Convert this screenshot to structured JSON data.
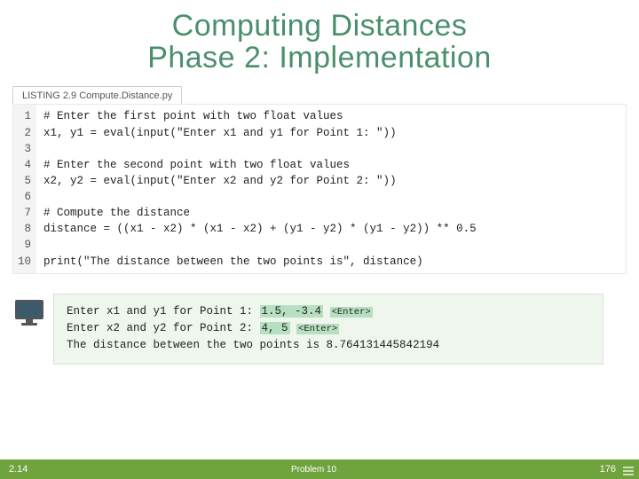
{
  "title": {
    "line1": "Computing Distances",
    "line2": "Phase 2: Implementation"
  },
  "listing_label": "LISTING 2.9 Compute.Distance.py",
  "code": {
    "gutter": "1\n2\n3\n4\n5\n6\n7\n8\n9\n10",
    "body": "# Enter the first point with two float values\nx1, y1 = eval(input(\"Enter x1 and y1 for Point 1: \"))\n\n# Enter the second point with two float values\nx2, y2 = eval(input(\"Enter x2 and y2 for Point 2: \"))\n\n# Compute the distance\ndistance = ((x1 - x2) * (x1 - x2) + (y1 - y2) * (y1 - y2)) ** 0.5\n\nprint(\"The distance between the two points is\", distance)"
  },
  "terminal": {
    "l1a": "Enter x1 and y1 for Point 1: ",
    "l1b": "1.5, -3.4",
    "enter": "<Enter>",
    "l2a": "Enter x2 and y2 for Point 2: ",
    "l2b": "4, 5",
    "l3": "The distance between the two points is 8.764131445842194"
  },
  "footer": {
    "left": "2.14",
    "center": "Problem 10",
    "right": "176"
  }
}
